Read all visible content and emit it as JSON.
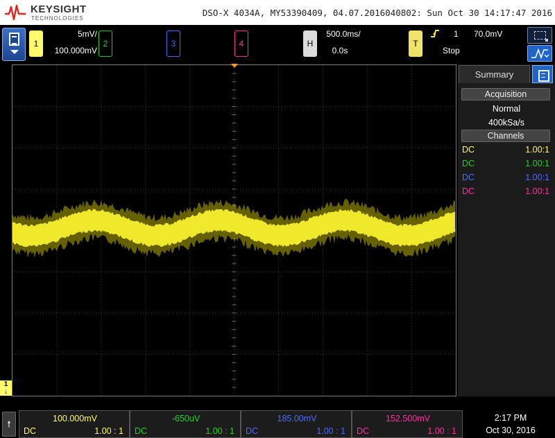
{
  "header": {
    "brand": "KEYSIGHT",
    "brand_sub": "TECHNOLOGIES",
    "title": "DSO-X 4034A, MY53390409, 04.07.2016040802: Sun Oct 30 14:17:47 2016"
  },
  "controls": {
    "ch1": {
      "label": "1",
      "scale": "5mV/",
      "offset": "100.000mV",
      "color": "#fffb6a"
    },
    "ch2": {
      "label": "2",
      "color": "#21d321"
    },
    "ch3": {
      "label": "3",
      "color": "#4a6bff"
    },
    "ch4": {
      "label": "4",
      "color": "#ff2fa3"
    },
    "horizontal": {
      "label": "H",
      "scale": "500.0ms/",
      "position": "0.0s"
    },
    "trigger": {
      "label": "T",
      "edge_icon": "rising-edge-icon",
      "source": "1",
      "level": "70.0mV",
      "state": "Stop"
    }
  },
  "side_panel": {
    "tab": "Summary",
    "acquisition_header": "Acquisition",
    "acq_mode": "Normal",
    "sample_rate": "400kSa/s",
    "channels_header": "Channels",
    "channels": [
      {
        "coupling": "DC",
        "probe": "1.00:1",
        "color": "#fffb6a"
      },
      {
        "coupling": "DC",
        "probe": "1.00:1",
        "color": "#21d321"
      },
      {
        "coupling": "DC",
        "probe": "1.00:1",
        "color": "#4a6bff"
      },
      {
        "coupling": "DC",
        "probe": "1.00:1",
        "color": "#ff2fa3"
      }
    ]
  },
  "ground_marker": "1",
  "bottom": {
    "channels": [
      {
        "offset": "100.000mV",
        "coupling": "DC",
        "probe": "1.00 : 1",
        "color": "#fffb6a"
      },
      {
        "offset": "-650uV",
        "coupling": "DC",
        "probe": "1.00 : 1",
        "color": "#21d321"
      },
      {
        "offset": "185.00mV",
        "coupling": "DC",
        "probe": "1.00 : 1",
        "color": "#4a6bff"
      },
      {
        "offset": "152.500mV",
        "coupling": "DC",
        "probe": "1.00 : 1",
        "color": "#ff2fa3"
      }
    ],
    "time": "2:17 PM",
    "date": "Oct 30, 2016"
  }
}
